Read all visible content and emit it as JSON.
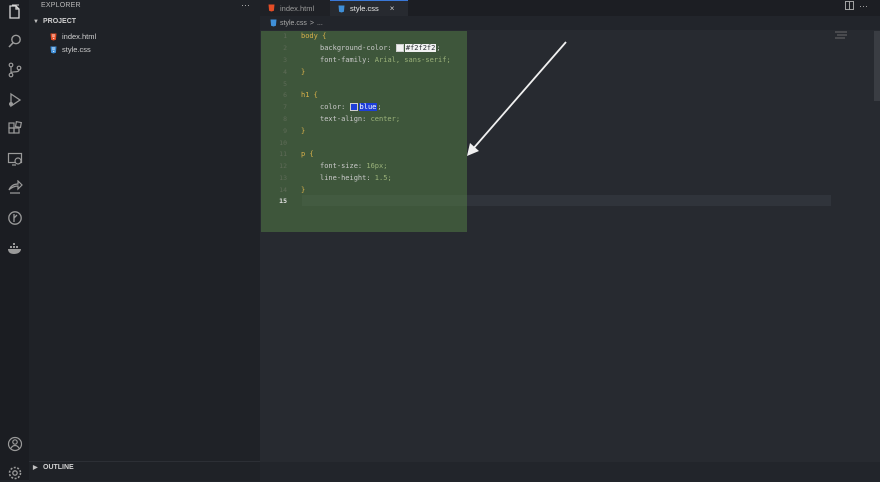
{
  "sidebar": {
    "title": "EXPLORER",
    "more": "···",
    "project_label": "PROJECT",
    "files": [
      {
        "name": "index.html",
        "icon": "html-file-icon",
        "color": "#e44d26"
      },
      {
        "name": "style.css",
        "icon": "css-file-icon",
        "color": "#3f8fd8"
      }
    ],
    "outline_label": "OUTLINE"
  },
  "tabs": [
    {
      "label": "index.html",
      "active": false
    },
    {
      "label": "style.css",
      "active": true,
      "close": "×"
    }
  ],
  "breadcrumb": {
    "file": "style.css",
    "sep": ">",
    "rest": "..."
  },
  "code": {
    "lines": [
      {
        "n": "1"
      },
      {
        "n": "2"
      },
      {
        "n": "3"
      },
      {
        "n": "4"
      },
      {
        "n": "5"
      },
      {
        "n": "6"
      },
      {
        "n": "7"
      },
      {
        "n": "8"
      },
      {
        "n": "9"
      },
      {
        "n": "10"
      },
      {
        "n": "11"
      },
      {
        "n": "12"
      },
      {
        "n": "13"
      },
      {
        "n": "14"
      },
      {
        "n": "15"
      }
    ],
    "body_sel": "body",
    "open": "{",
    "close": "}",
    "bg_prop": "background-color: ",
    "bg_val": "#f2f2f2",
    "semi": ";",
    "ff_prop": "font-family: ",
    "ff_val": "Arial, sans-serif;",
    "h1_sel": "h1",
    "color_prop": "color: ",
    "color_val": "blue",
    "ta_prop": "text-align: ",
    "ta_val": "center;",
    "p_sel": "p",
    "fs_prop": "font-size: ",
    "fs_val": "16px;",
    "lh_prop": "line-height: ",
    "lh_val": "1.5;"
  },
  "colors": {
    "accent": "#3a78d8",
    "highlight": "#5c8c4a",
    "blue_swatch": "#1e3fd8"
  }
}
